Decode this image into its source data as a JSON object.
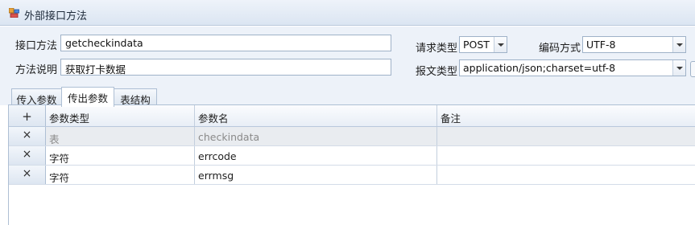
{
  "window": {
    "title": "外部接口方法"
  },
  "form": {
    "method_label": "接口方法",
    "method_value": "getcheckindata",
    "desc_label": "方法说明",
    "desc_value": "获取打卡数据",
    "request_type_label": "请求类型",
    "request_type_value": "POST",
    "encoding_label": "编码方式",
    "encoding_value": "UTF-8",
    "content_type_label": "报文类型",
    "content_type_value": "application/json;charset=utf-8"
  },
  "tabs": [
    {
      "label": "传入参数"
    },
    {
      "label": "传出参数"
    },
    {
      "label": "表结构"
    }
  ],
  "active_tab": "传出参数",
  "grid": {
    "add_symbol": "+",
    "remove_symbol": "×",
    "columns": [
      "参数类型",
      "参数名",
      "备注"
    ],
    "rows": [
      {
        "type": "表",
        "name": "checkindata",
        "note": "",
        "disabled": true
      },
      {
        "type": "字符",
        "name": "errcode",
        "note": ""
      },
      {
        "type": "字符",
        "name": "errmsg",
        "note": ""
      }
    ]
  },
  "colors": {
    "accent": "#edf2f9",
    "border": "#9fb2c8",
    "disabled_row": "#e9ecf0"
  }
}
